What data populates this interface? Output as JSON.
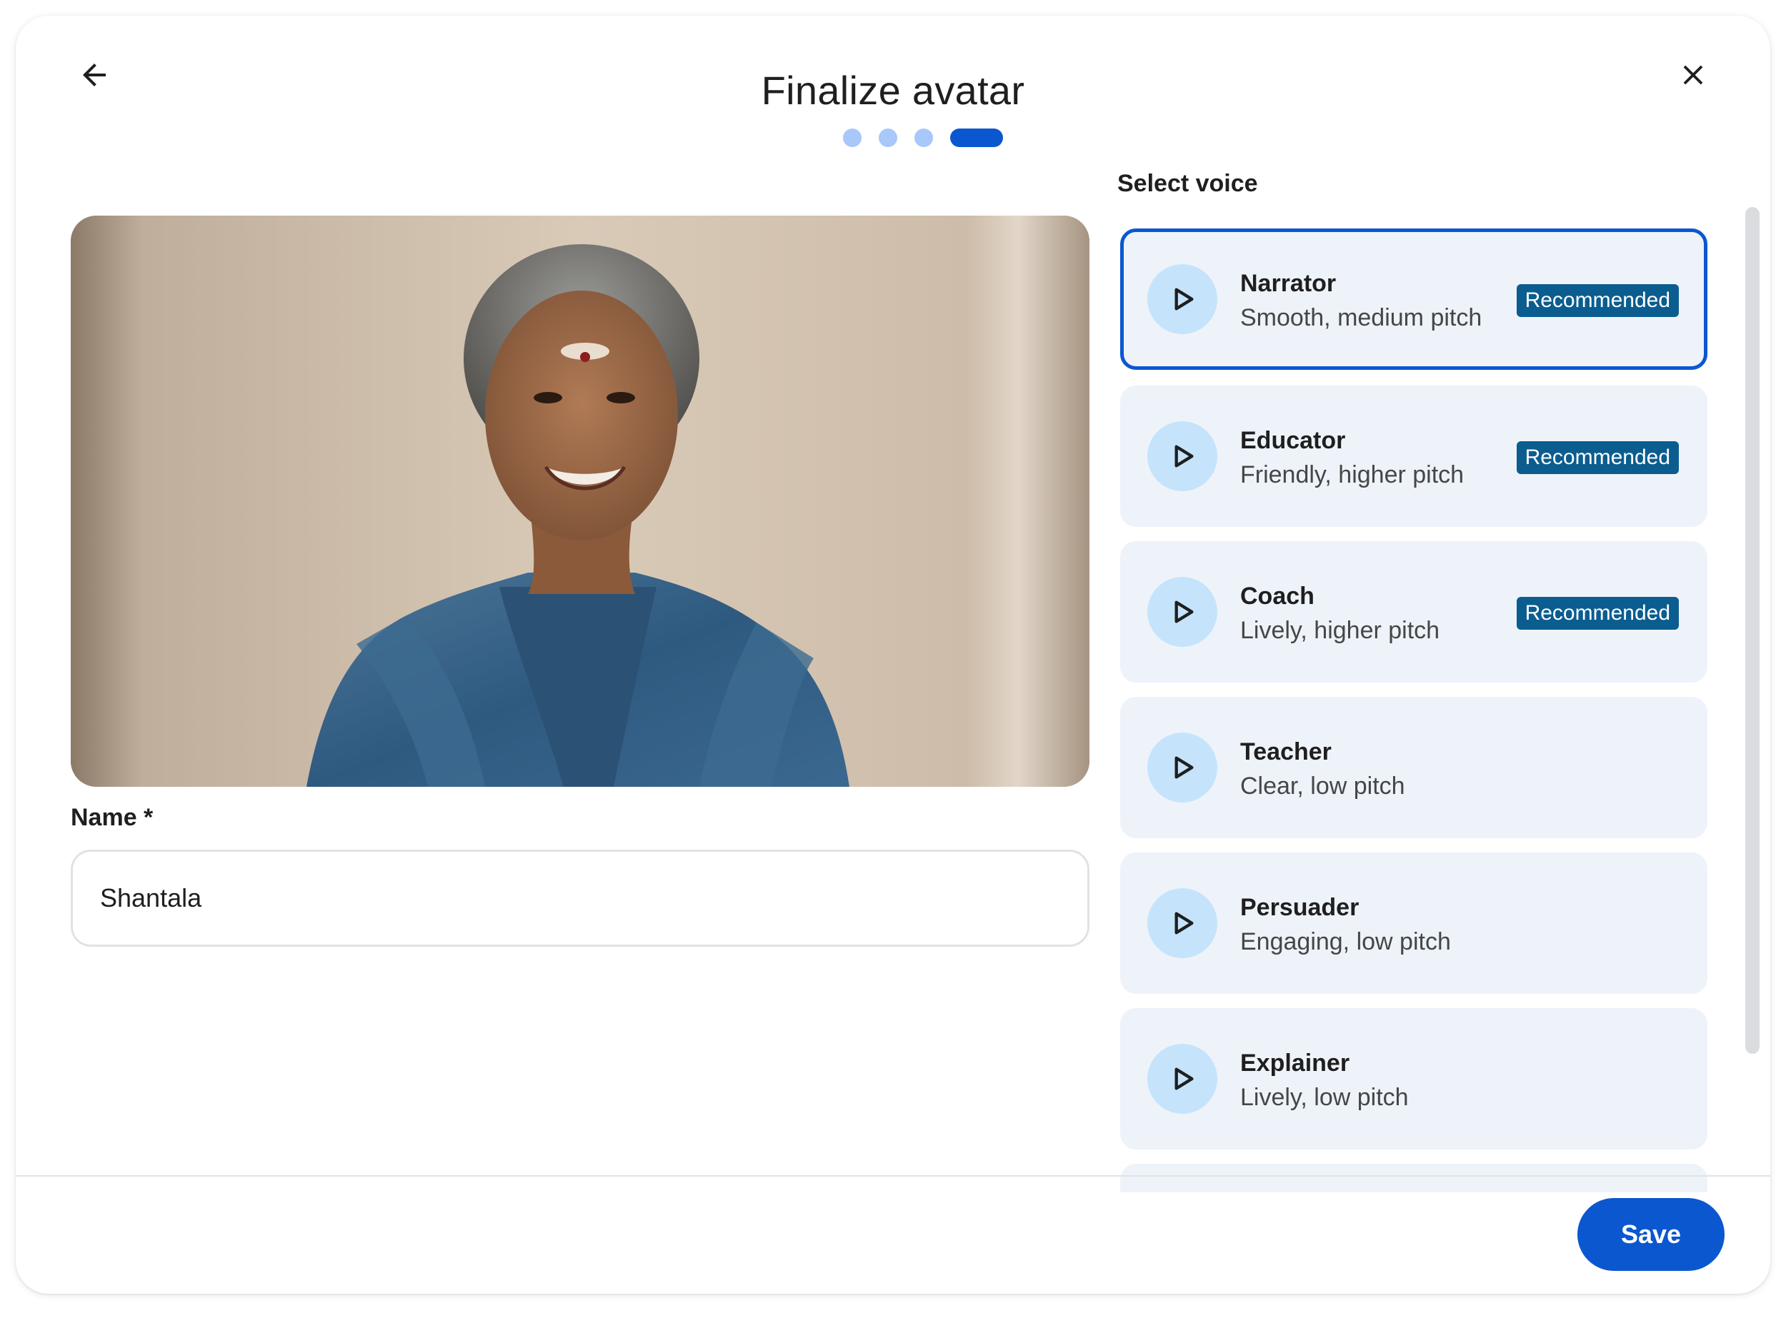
{
  "header": {
    "title": "Finalize avatar",
    "back_icon": "arrow-back-icon",
    "close_icon": "close-icon",
    "steps_total": 4,
    "current_step": 4
  },
  "avatar": {
    "image_icon": "avatar-photo"
  },
  "name_field": {
    "label": "Name *",
    "value": "Shantala"
  },
  "voice": {
    "header": "Select voice",
    "options": [
      {
        "name": "Narrator",
        "description": "Smooth, medium pitch",
        "badge": "Recommended",
        "selected": true
      },
      {
        "name": "Educator",
        "description": "Friendly, higher pitch",
        "badge": "Recommended",
        "selected": false
      },
      {
        "name": "Coach",
        "description": "Lively, higher pitch",
        "badge": "Recommended",
        "selected": false
      },
      {
        "name": "Teacher",
        "description": "Clear, low pitch",
        "badge": "",
        "selected": false
      },
      {
        "name": "Persuader",
        "description": "Engaging, low pitch",
        "badge": "",
        "selected": false
      },
      {
        "name": "Explainer",
        "description": "Lively, low pitch",
        "badge": "",
        "selected": false
      }
    ]
  },
  "footer": {
    "save_label": "Save"
  },
  "colors": {
    "primary": "#0b57d0",
    "step_inactive": "#a8c7fa",
    "card_bg": "#eef3fa",
    "play_bg": "#c5e4fb",
    "badge_bg": "#0b5d8f"
  }
}
